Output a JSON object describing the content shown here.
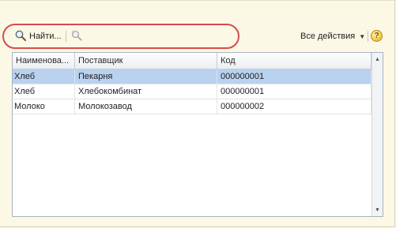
{
  "toolbar": {
    "find_label": "Найти...",
    "actions_label": "Все действия",
    "help_label": "?"
  },
  "table": {
    "columns": [
      "Наименова...",
      "Поставщик",
      "Код"
    ],
    "rows": [
      {
        "name": "Хлеб",
        "supplier": "Пекарня",
        "code": "000000001",
        "selected": true
      },
      {
        "name": "Хлеб",
        "supplier": "Хлебокомбинат",
        "code": "000000001",
        "selected": false
      },
      {
        "name": "Молоко",
        "supplier": "Молокозавод",
        "code": "000000002",
        "selected": false
      }
    ]
  },
  "colors": {
    "background": "#fbf8e6",
    "selection": "#b8d2ef",
    "annotation": "#d94a4a"
  },
  "icons": {
    "find": "magnifier-icon",
    "clear": "clear-search-icon",
    "caret": "chevron-down-icon",
    "help": "help-icon"
  }
}
